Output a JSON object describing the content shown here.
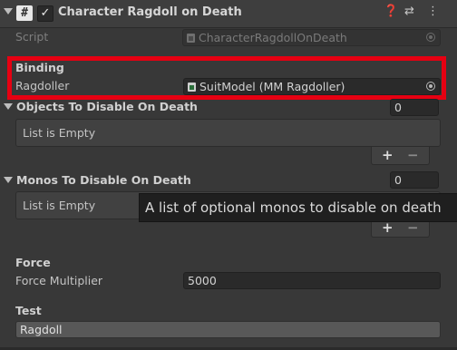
{
  "component": {
    "script_glyph": "#",
    "check_glyph": "✓",
    "title": "Character Ragdoll on Death",
    "icons": [
      "help-icon",
      "preset-icon",
      "menu-icon"
    ],
    "icon_glyphs": {
      "help": "❓",
      "preset": "⇄",
      "menu": "⋮"
    }
  },
  "script": {
    "label": "Script",
    "value": "CharacterRagdollOnDeath"
  },
  "binding": {
    "header": "Binding",
    "ragdoller_label": "Ragdoller",
    "ragdoller_value": "SuitModel (MM Ragdoller)"
  },
  "objects_list": {
    "label": "Objects To Disable On Death",
    "count": "0",
    "empty_text": "List is Empty"
  },
  "monos_list": {
    "label": "Monos To Disable On Death",
    "count": "0",
    "empty_text": "List is Empty"
  },
  "list_buttons": {
    "plus": "+",
    "minus": "−"
  },
  "tooltip": {
    "text": "A list of optional monos to disable on death"
  },
  "force": {
    "header": "Force",
    "multiplier_label": "Force Multiplier",
    "multiplier_value": "5000"
  },
  "test": {
    "header": "Test",
    "button_label": "Ragdoll"
  },
  "colors": {
    "highlight": "#e60012",
    "background": "#383838",
    "field": "#2a2a2a"
  }
}
